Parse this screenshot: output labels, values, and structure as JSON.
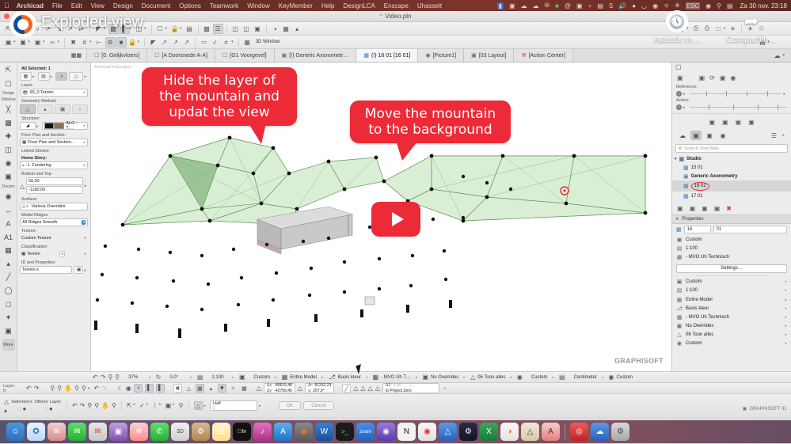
{
  "macbar": {
    "apple": "",
    "menus": [
      "Archicad",
      "File",
      "Edit",
      "View",
      "Design",
      "Document",
      "Options",
      "Teamwork",
      "Window",
      "KeyMember",
      "Help",
      "DesignLCA",
      "Enscape",
      "Uhasselt"
    ],
    "status_icons": [
      "display-icon",
      "screenshot-icon",
      "cloud-icon",
      "cloud-icon",
      "compass-icon",
      "battery-icon",
      "at-icon",
      "box-icon",
      "record-icon",
      "grid-icon",
      "spotify-icon",
      "volume-icon",
      "user-icon",
      "headphone-icon",
      "timemachine-icon",
      "bluetooth-icon",
      "power-icon",
      "keyboard-icon",
      "wifi-icon",
      "search-icon",
      "controlcenter-icon"
    ],
    "clock": "Za 30 nov. 23:18"
  },
  "window": {
    "title": "Video.pln"
  },
  "youtube_overlay": {
    "channel_title": "Exploded view",
    "watch_later": "Assistir m…",
    "share": "Compartilh…",
    "play_button": "play-icon"
  },
  "toolbar1": {
    "items": [
      "arrow-tool",
      "marquee-tool",
      "wand-tool",
      "line-tool",
      "polyline-tool",
      "arc-tool",
      "rotate-tool",
      "dimension-tool",
      "text-tool",
      "label-tool",
      "hotlink-tool",
      "door-tool",
      "window-tool",
      "object-tool",
      "lamp-tool",
      "zone-tool",
      "curtain-wall",
      "mesh-tool",
      "stair-tool",
      "railing-tool",
      "morph-tool",
      "shell-tool",
      "roof-tool",
      "beam-tool",
      "column-tool",
      "slab-tool",
      "wall-tool"
    ]
  },
  "toolbar2": {
    "items": [
      "view-mode",
      "camera",
      "layer-settings",
      "pen-settings",
      "grid-snap",
      "guide-lines",
      "magic-wand",
      "lock",
      "measure",
      "trim",
      "split",
      "offset",
      "multiply",
      "adjust",
      "intersect",
      "fillet"
    ]
  },
  "tabs": {
    "lead_icon": "tab-overview-icon",
    "items": [
      {
        "label": "[0. Gelijkvloers]",
        "icon": "floorplan-icon",
        "active": false
      },
      {
        "label": "[A Doorsnede A-A]",
        "icon": "section-icon",
        "active": false
      },
      {
        "label": "[G1 Voorgevel]",
        "icon": "elevation-icon",
        "active": false
      },
      {
        "label": "[!) Generic Axonometr…",
        "icon": "axono-icon",
        "active": false
      },
      {
        "label": "(!) 16 01 [16 01]",
        "icon": "3d-icon",
        "active": true
      },
      {
        "label": "[Picture1]",
        "icon": "picture-icon",
        "active": false
      },
      {
        "label": "[03 Layout]",
        "icon": "layout-icon",
        "active": false
      },
      {
        "label": "[Action Center]",
        "icon": "action-center-icon",
        "active": false
      }
    ]
  },
  "left_rail": {
    "groups": [
      "Design",
      "Window",
      "Docum",
      "More"
    ],
    "tools": [
      "arrow-tool-icon",
      "marquee-tool-icon",
      "wall-tool-icon",
      "column-tool-icon",
      "beam-tool-icon",
      "slab-tool-icon",
      "roof-tool-icon",
      "mesh-tool-icon",
      "camera-icon",
      "zone-icon",
      "dimension-icon",
      "text-icon",
      "label-icon",
      "line-icon",
      "circle-icon",
      "polyline-icon",
      "spline-icon",
      "hotspot-icon",
      "figure-icon"
    ]
  },
  "info_panel": {
    "selection_header": "All Selected: 1",
    "layer_label": "Layer:",
    "layer_value": "90_0 Terrein",
    "geometry_label": "Geometry Method:",
    "geometry_methods": [
      "mesh-solid",
      "mesh-top",
      "mesh-box",
      "mesh-ghost"
    ],
    "structure_label": "Structure:",
    "structure_value": "ALG - T…",
    "structure_colors": [
      "#111111",
      "#8a7056"
    ],
    "floorplan_label": "Floor Plan and Section:",
    "floorplan_value": "Floor Plan and Section…",
    "linked_stories_label": "Linked Stories:",
    "home_story_label": "Home Story:",
    "home_story_value": "-1. Fundering",
    "bottom_top_label": "Bottom and Top:",
    "bottom_value": "50,00",
    "top_value": "-1180,00",
    "surface_label": "Surface:",
    "surface_value": "Various Overrides",
    "ridges_label": "Model Ridges:",
    "ridges_value": "All Ridges Smooth",
    "texture_label": "Texture:",
    "texture_value": "Custom Texture",
    "classification_label": "Classification:",
    "classification_value": "Terrein",
    "id_label": "ID and Properties:",
    "id_value": "Terrein-x"
  },
  "viewport": {
    "watermark": "Archicad Education",
    "logo": "GRAPHISOFT",
    "callout1": "Hide the layer of the mountain and updat the view",
    "callout2": "Move the mountain to the background"
  },
  "right_panel": {
    "reference_label": "Reference:",
    "active_label": "Active:",
    "view_tabs": [
      "project-map-icon",
      "view-map-icon",
      "layout-book-icon",
      "publisher-icon"
    ],
    "search_placeholder": "Search View Map",
    "tree": [
      {
        "label": "Studio",
        "level": 0,
        "icon": "folder-icon",
        "selected": false
      },
      {
        "label": "15 01",
        "level": 1,
        "icon": "3d-view-icon",
        "selected": false
      },
      {
        "label": "Generic Axonometry",
        "level": 1,
        "icon": "axono-icon",
        "selected": false
      },
      {
        "label": "16 01",
        "level": 1,
        "icon": "3d-view-icon",
        "selected": true,
        "highlighted": true
      },
      {
        "label": "17 01",
        "level": 1,
        "icon": "3d-view-icon",
        "selected": false
      }
    ],
    "properties_header": "Properties",
    "id_a": "16",
    "id_b": "01",
    "quick_rows": [
      {
        "label": "Custom",
        "icon": "layer-combo-icon"
      },
      {
        "label": "1:100",
        "icon": "scale-icon"
      },
      {
        "label": "-  MVO Uh Technisch",
        "icon": "pen-set-icon"
      }
    ],
    "settings_button": "Settings…",
    "rows": [
      {
        "label": "Custom",
        "icon": "layer-combo-icon"
      },
      {
        "label": "1:100",
        "icon": "scale-icon"
      },
      {
        "label": "Entire Model",
        "icon": "model-view-icon"
      },
      {
        "label": "Basis kleur",
        "icon": "pen-icon"
      },
      {
        "label": "-  MVO Uh Technisch",
        "icon": "pen-set-icon"
      },
      {
        "label": "No Overrides",
        "icon": "override-icon"
      },
      {
        "label": "06 Toon alles",
        "icon": "renovation-icon"
      },
      {
        "label": "Custom",
        "icon": "custom-icon"
      }
    ],
    "toolbar_icons": [
      "new-view-icon",
      "clone-folder-icon",
      "new-folder-icon",
      "rename-icon",
      "delete-icon"
    ]
  },
  "status_bar_top": {
    "zoom": "37%",
    "angle": "0,0°",
    "scale": "1:100",
    "layer_combo": "Custom",
    "model_view": "Entire Model",
    "pen_set": "Basis kleur",
    "graphic_override": "-  MVO Uh T…",
    "overrides": "No Overrides",
    "renovation": "06 Toon alles",
    "custom": "Custom",
    "unit": "Centimeter",
    "custom2": "Custom"
  },
  "status_bar_bottom": {
    "layer_label": "Layer:",
    "layer_value": "0",
    "dx_label": "Δx:",
    "dx_value": "-80615,48",
    "dy_label": "Δy:",
    "dy_value": "-42756,45",
    "dr_label": "Δr:",
    "dr_value": "81252,23",
    "angle_label": "a:",
    "angle_value": "207,9°",
    "dz_label": "ΔZ:",
    "dz_value": "0,00",
    "origin": "to Project Zero"
  },
  "bottom_toolbar": {
    "selection_label": "Selection's",
    "others_layer_label": "Others' Layer:",
    "half_label": "Half",
    "half_value": "2",
    "ok": "OK",
    "cancel": "Cancel"
  },
  "footer": {
    "brand": "GRAPHISOFT ID"
  },
  "dock": {
    "apps": [
      "finder-icon",
      "safari-icon",
      "mail-icon",
      "messages-icon",
      "outlook-icon",
      "teams-icon",
      "photos-icon",
      "whatsapp-icon",
      "3d-icon",
      "preferences-icon",
      "notes-icon",
      "appletv-icon",
      "music-icon",
      "appstore-icon",
      "blender-icon",
      "word-icon",
      "terminal-icon",
      "zoom-icon",
      "orbit-icon",
      "notion-icon",
      "chrome-icon",
      "drive-icon",
      "steam-icon",
      "excel-icon",
      "archicad-icon",
      "sketch-icon",
      "acrobat-icon",
      "opera-icon",
      "onedrive-icon",
      "trash-icon"
    ]
  },
  "colors": {
    "callout_red": "#ec2a38",
    "mesh_green": "#d7ecd2",
    "mesh_stroke": "#5f9a5b",
    "accent_blue": "#4a7fb5"
  },
  "chart_data": null
}
